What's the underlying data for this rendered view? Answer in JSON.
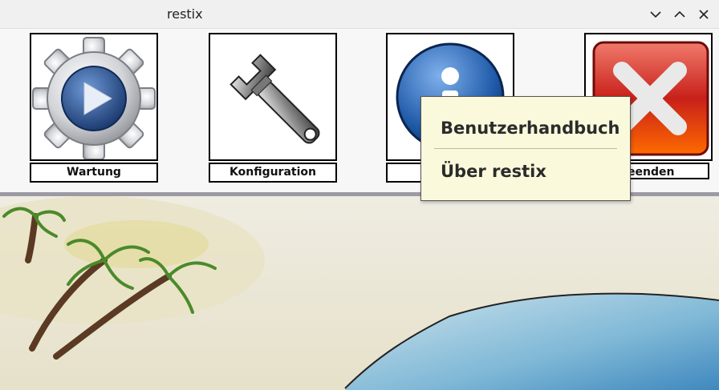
{
  "window": {
    "title": "restix"
  },
  "toolbar": {
    "items": [
      {
        "label": "Wartung",
        "icon": "gear-play-icon"
      },
      {
        "label": "Konfiguration",
        "icon": "wrench-icon"
      },
      {
        "label": "",
        "icon": "info-icon"
      },
      {
        "label": "eenden",
        "icon": "close-x-icon"
      }
    ]
  },
  "menu": {
    "items": [
      {
        "label": "Benutzerhandbuch"
      },
      {
        "label": "Über restix"
      }
    ]
  },
  "colors": {
    "menu_bg": "#fbf9dc",
    "info_blue": "#1f5aa8",
    "exit_red": "#c8201a",
    "sea": "#7fb8d6",
    "sand": "#e8e2c8"
  }
}
